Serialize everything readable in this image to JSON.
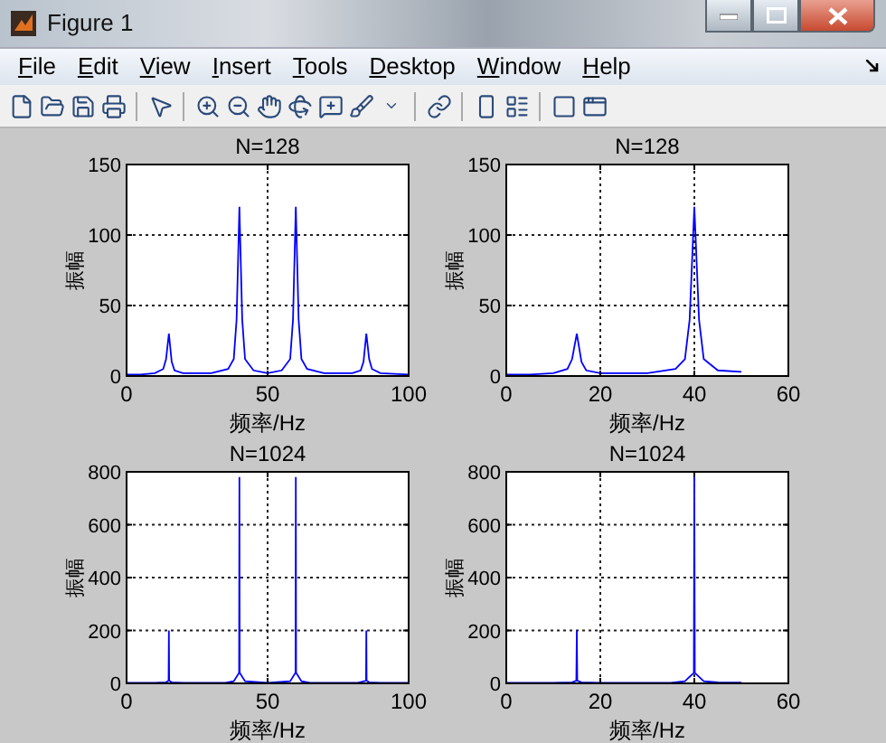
{
  "window": {
    "title": "Figure 1"
  },
  "menu": [
    "File",
    "Edit",
    "View",
    "Insert",
    "Tools",
    "Desktop",
    "Window",
    "Help"
  ],
  "subplots": [
    {
      "chart_data": {
        "type": "line",
        "grid": true,
        "title": "N=128",
        "xlabel": "频率/Hz",
        "ylabel": "振幅",
        "xlim": [
          0,
          100
        ],
        "ylim": [
          0,
          150
        ],
        "xticks": [
          0,
          50,
          100
        ],
        "yticks": [
          0,
          50,
          100,
          150
        ],
        "x": [
          0,
          5,
          10,
          13,
          14,
          15,
          16,
          17,
          20,
          30,
          36,
          38,
          39,
          40,
          41,
          42,
          45,
          50,
          55,
          58,
          59,
          60,
          61,
          62,
          64,
          70,
          80,
          83,
          84,
          85,
          86,
          87,
          90,
          100
        ],
        "series": [
          {
            "color": "#0000ff",
            "values": [
              1,
              1,
              2,
              5,
              12,
              30,
              10,
              4,
              2,
              2,
              5,
              12,
              40,
              120,
              40,
              12,
              4,
              2,
              4,
              12,
              40,
              120,
              40,
              12,
              5,
              2,
              2,
              4,
              10,
              30,
              12,
              5,
              2,
              1
            ]
          }
        ]
      }
    },
    {
      "chart_data": {
        "type": "line",
        "grid": true,
        "title": "N=128",
        "xlabel": "频率/Hz",
        "ylabel": "振幅",
        "xlim": [
          0,
          60
        ],
        "ylim": [
          0,
          150
        ],
        "xticks": [
          0,
          20,
          40,
          60
        ],
        "yticks": [
          0,
          50,
          100,
          150
        ],
        "x": [
          0,
          5,
          10,
          13,
          14,
          15,
          16,
          17,
          20,
          30,
          36,
          38,
          39,
          40,
          41,
          42,
          45,
          50
        ],
        "series": [
          {
            "color": "#0000ff",
            "values": [
              1,
              1,
              2,
              5,
              12,
              30,
              10,
              4,
              2,
              2,
              5,
              12,
              40,
              120,
              40,
              12,
              4,
              3
            ]
          }
        ]
      }
    },
    {
      "chart_data": {
        "type": "line",
        "grid": true,
        "title": "N=1024",
        "xlabel": "频率/Hz",
        "ylabel": "振幅",
        "xlim": [
          0,
          100
        ],
        "ylim": [
          0,
          800
        ],
        "xticks": [
          0,
          50,
          100
        ],
        "yticks": [
          0,
          200,
          400,
          600,
          800
        ],
        "x": [
          0,
          10,
          14,
          14.9,
          15,
          15.1,
          16,
          20,
          35,
          38,
          39.9,
          40,
          40.1,
          42,
          50,
          58,
          59.9,
          60,
          60.1,
          62,
          65,
          82,
          84.9,
          85,
          85.1,
          86,
          90,
          100
        ],
        "series": [
          {
            "color": "#0000ff",
            "values": [
              2,
              2,
              4,
              10,
              200,
              10,
              4,
              2,
              2,
              8,
              40,
              780,
              40,
              8,
              2,
              8,
              40,
              780,
              40,
              8,
              2,
              2,
              10,
              200,
              10,
              4,
              2,
              2
            ]
          }
        ]
      }
    },
    {
      "chart_data": {
        "type": "line",
        "grid": true,
        "title": "N=1024",
        "xlabel": "频率/Hz",
        "ylabel": "振幅",
        "xlim": [
          0,
          60
        ],
        "ylim": [
          0,
          800
        ],
        "xticks": [
          0,
          20,
          40,
          60
        ],
        "yticks": [
          0,
          200,
          400,
          600,
          800
        ],
        "x": [
          0,
          10,
          14,
          14.9,
          15,
          15.1,
          16,
          20,
          35,
          38,
          39.9,
          40,
          40.1,
          42,
          45,
          50
        ],
        "series": [
          {
            "color": "#0000ff",
            "values": [
              2,
              2,
              4,
              10,
              200,
              10,
              4,
              2,
              2,
              8,
              40,
              800,
              40,
              8,
              4,
              3
            ]
          }
        ]
      }
    }
  ]
}
